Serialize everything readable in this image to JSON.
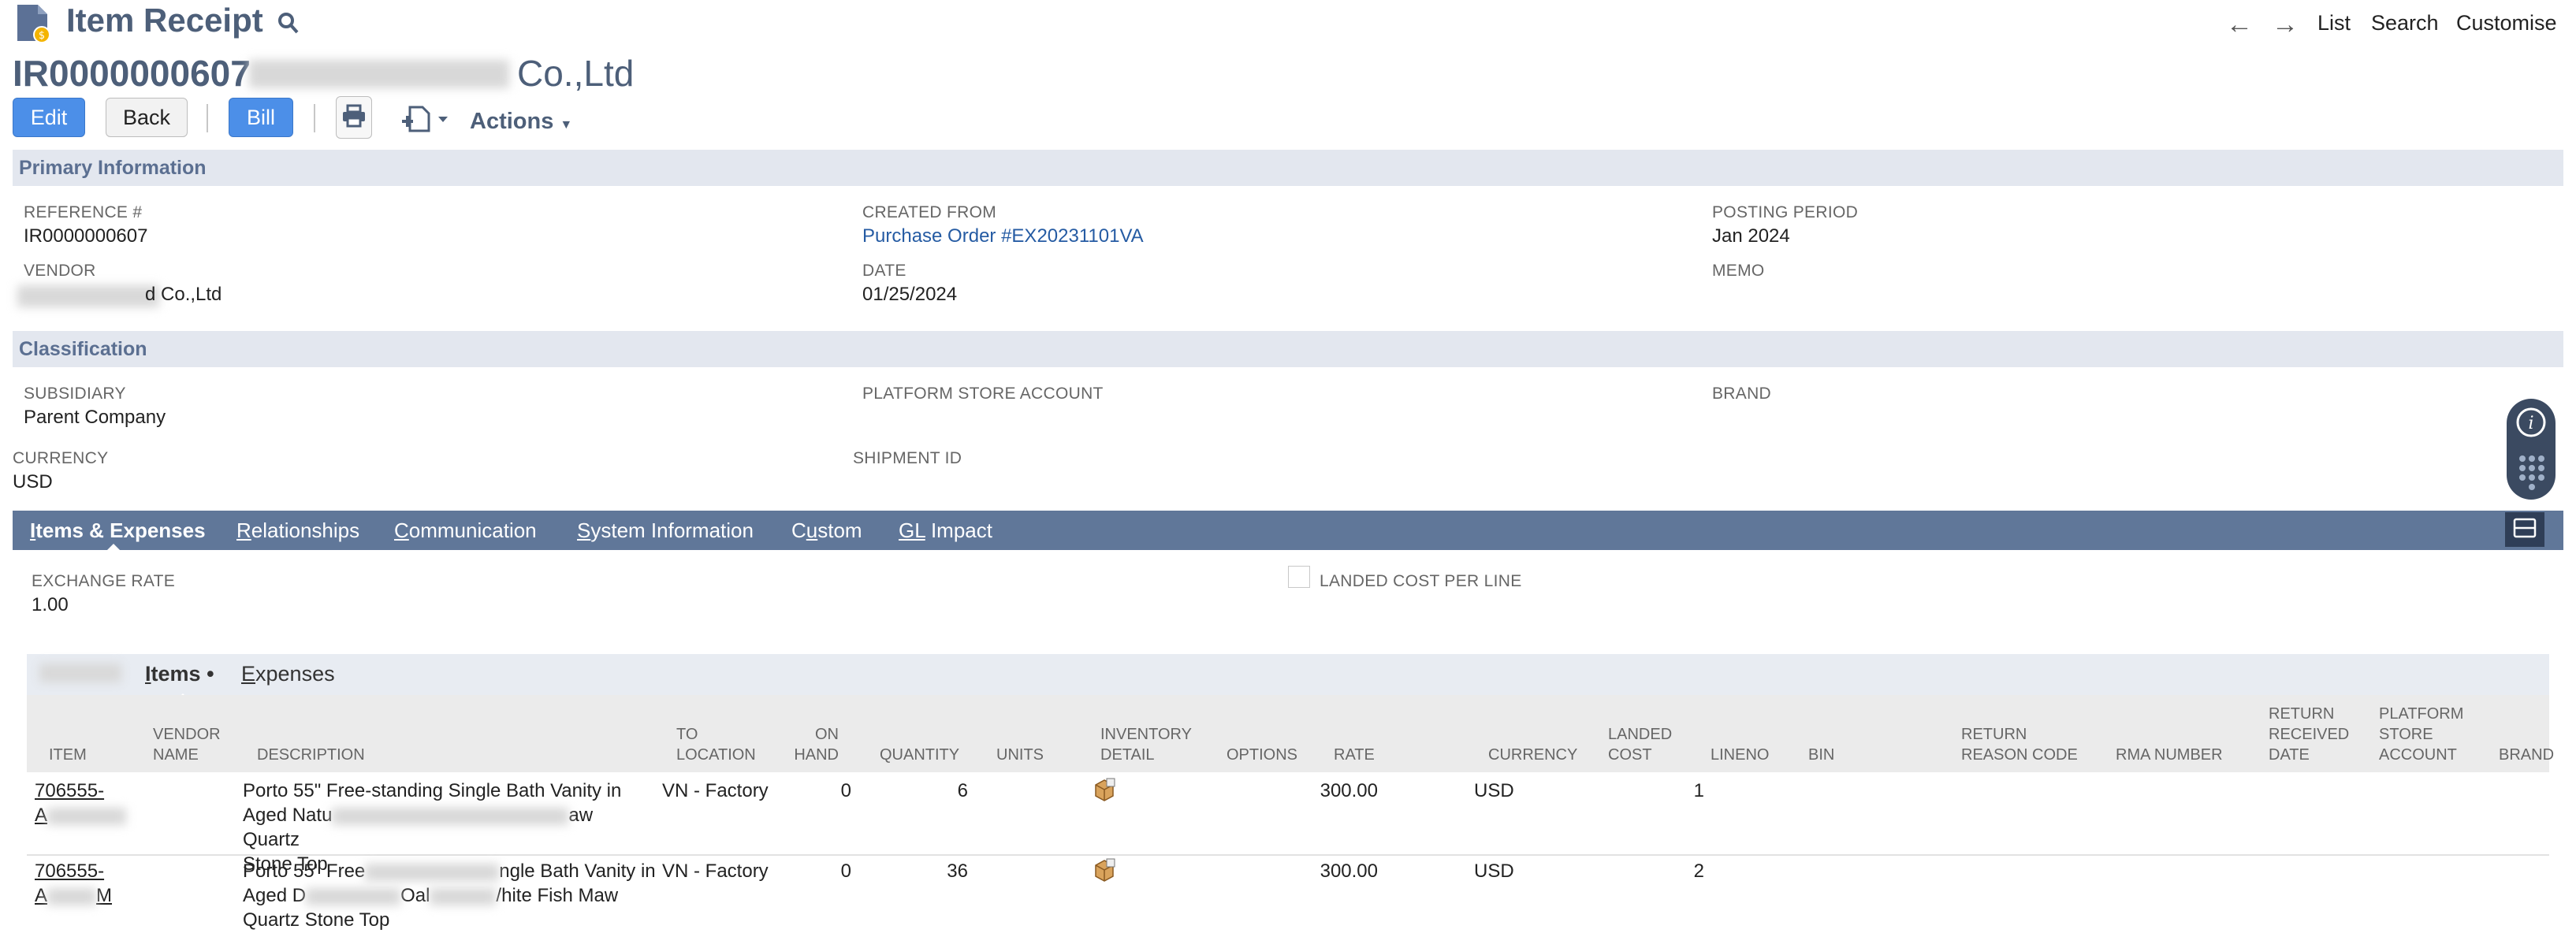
{
  "header": {
    "page_title": "Item Receipt",
    "nav": {
      "list": "List",
      "search": "Search",
      "customise": "Customise"
    },
    "record_number": "IR0000000607",
    "vendor_name_visible": "Co.,Ltd"
  },
  "toolbar": {
    "edit": "Edit",
    "back": "Back",
    "bill": "Bill",
    "actions": "Actions"
  },
  "primary": {
    "section_title": "Primary Information",
    "reference_label": "REFERENCE #",
    "reference_value": "IR0000000607",
    "created_from_label": "CREATED FROM",
    "created_from_value": "Purchase Order #EX20231101VA",
    "posting_period_label": "POSTING PERIOD",
    "posting_period_value": "Jan 2024",
    "vendor_label": "VENDOR",
    "vendor_value_visible": "d Co.,Ltd",
    "date_label": "DATE",
    "date_value": "01/25/2024",
    "memo_label": "MEMO"
  },
  "classification": {
    "section_title": "Classification",
    "subsidiary_label": "SUBSIDIARY",
    "subsidiary_value": "Parent Company",
    "platform_store_label": "PLATFORM STORE ACCOUNT",
    "brand_label": "BRAND",
    "currency_label": "CURRENCY",
    "currency_value": "USD",
    "shipment_label": "SHIPMENT ID"
  },
  "tabs": [
    {
      "label": "Items & Expenses",
      "key": "I",
      "rest": "tems & Expenses"
    },
    {
      "label": "Relationships",
      "key": "R",
      "rest": "elationships"
    },
    {
      "label": "Communication",
      "key": "C",
      "rest": "ommunication"
    },
    {
      "label": "System Information",
      "key": "S",
      "rest": "ystem Information"
    },
    {
      "label": "Custom",
      "pre": "C",
      "key": "u",
      "rest": "stom"
    },
    {
      "label": "GL Impact",
      "key": "GL",
      "rest": " Impact"
    }
  ],
  "items_tab": {
    "exchange_rate_label": "EXCHANGE RATE",
    "exchange_rate_value": "1.00",
    "landed_cost_label": "LANDED COST PER LINE",
    "subtabs": {
      "items": "Items",
      "items_key": "I",
      "items_rest": "tems",
      "expenses": "Expenses",
      "expenses_key": "E",
      "expenses_rest": "xpenses"
    }
  },
  "table": {
    "columns": {
      "item": "ITEM",
      "vendor_name_1": "VENDOR",
      "vendor_name_2": "NAME",
      "description": "DESCRIPTION",
      "to_location_1": "TO",
      "to_location_2": "LOCATION",
      "on_hand_1": "ON",
      "on_hand_2": "HAND",
      "quantity": "QUANTITY",
      "units": "UNITS",
      "inventory_detail_1": "INVENTORY",
      "inventory_detail_2": "DETAIL",
      "options": "OPTIONS",
      "rate": "RATE",
      "currency": "CURRENCY",
      "landed_cost_1": "LANDED",
      "landed_cost_2": "COST",
      "lineno": "LINENO",
      "bin": "BIN",
      "return_reason_1": "RETURN",
      "return_reason_2": "REASON CODE",
      "rma_number": "RMA NUMBER",
      "return_received_1": "RETURN",
      "return_received_2": "RECEIVED",
      "return_received_3": "DATE",
      "platform_store_1": "PLATFORM",
      "platform_store_2": "STORE",
      "platform_store_3": "ACCOUNT",
      "brand": "BRAND"
    },
    "rows": [
      {
        "item_1": "706555-",
        "item_2": "A",
        "desc_1": "Porto 55\" Free-standing Single Bath Vanity in",
        "desc_2a": "Aged Natu",
        "desc_2b": "aw Quartz",
        "desc_3": "Stone Top",
        "to_location": "VN - Factory",
        "on_hand": "0",
        "quantity": "6",
        "rate": "300.00",
        "currency": "USD",
        "lineno": "1"
      },
      {
        "item_1": "706555-",
        "item_2a": "A",
        "item_2b": "M",
        "desc_1a": "Porto 55\" Free",
        "desc_1b": "ngle Bath Vanity in",
        "desc_2a": "Aged D",
        "desc_2b": "Oal",
        "desc_2c": "/hite Fish Maw",
        "desc_3": "Quartz Stone Top",
        "to_location": "VN - Factory",
        "on_hand": "0",
        "quantity": "36",
        "rate": "300.00",
        "currency": "USD",
        "lineno": "2"
      }
    ]
  },
  "colors": {
    "title": "#4d5f79",
    "button_blue": "#4c8fe8",
    "tab_bar": "#607799",
    "section_bar": "#e3e7ef",
    "link": "#255ba3"
  },
  "icons": [
    "item-receipt-document-icon",
    "search-icon",
    "back-arrow-icon",
    "forward-arrow-icon",
    "print-icon",
    "new-document-icon",
    "inventory-detail-icon",
    "info-icon",
    "dialpad-icon",
    "collapse-tabs-icon"
  ]
}
